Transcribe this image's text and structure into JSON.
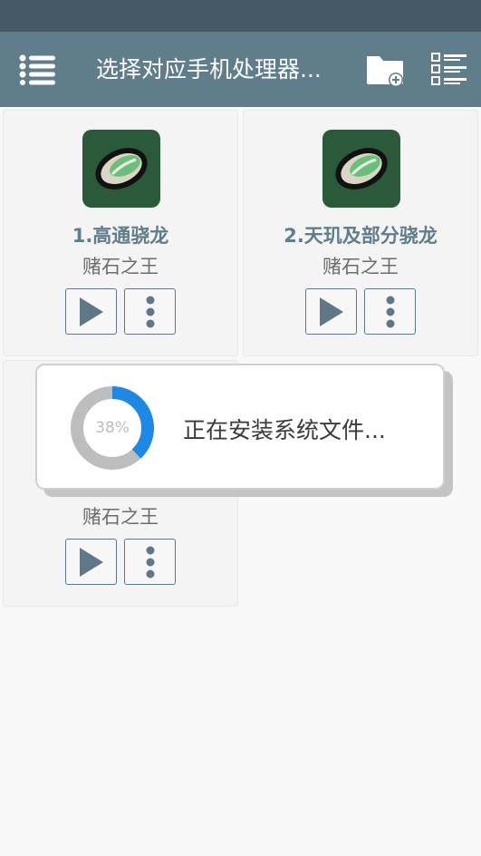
{
  "app_bar": {
    "title": "选择对应手机处理器...",
    "menu_icon": "menu-list-icon",
    "add_folder_icon": "folder-add-icon",
    "list_view_icon": "checklist-icon"
  },
  "cards": [
    {
      "title": "1.高通骁龙",
      "subtitle": "赌石之王",
      "icon": "green-gem-icon"
    },
    {
      "title": "2.天玑及部分骁龙",
      "subtitle": "赌石之王",
      "icon": "green-gem-icon"
    },
    {
      "title": "",
      "subtitle": "赌石之王",
      "icon": "green-gem-icon"
    }
  ],
  "dialog": {
    "progress_percent": 38,
    "progress_label": "38%",
    "message": "正在安装系统文件..."
  },
  "colors": {
    "status_bar": "#455a64",
    "app_bar": "#607d8b",
    "accent_progress": "#1e88e5",
    "progress_track": "#bdbdbd",
    "icon_bg": "#2b5a3a"
  }
}
